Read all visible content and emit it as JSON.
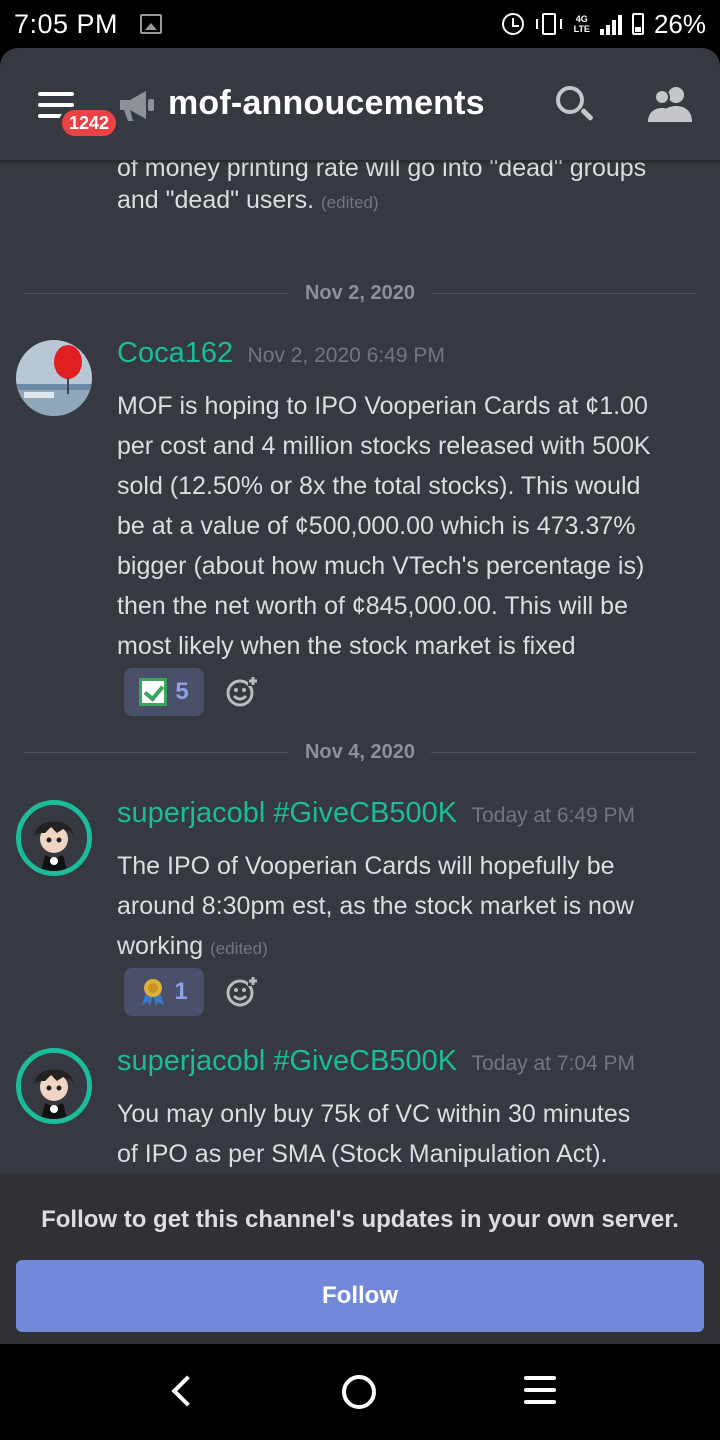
{
  "status_bar": {
    "time": "7:05 PM",
    "network": "4G\nLTE",
    "battery": "26%"
  },
  "header": {
    "unread_badge": "1242",
    "channel_name": "mof-annoucements"
  },
  "chat": {
    "previous_fragment_top": "of money printing rate will go into \"dead\" groups",
    "previous_fragment_bottom": "and \"dead\" users.",
    "edited_label": "(edited)",
    "dividers": [
      "Nov 2, 2020",
      "Nov 4, 2020"
    ],
    "messages": [
      {
        "username": "Coca162",
        "timestamp": "Nov 2, 2020 6:49 PM",
        "lines": [
          "MOF is hoping to IPO Vooperian Cards at ¢1.00",
          "per cost and 4 million stocks released with 500K",
          "sold (12.50% or 8x the total stocks). This would",
          "be at a value of ¢500,000.00 which is 473.37%",
          "bigger (about how much VTech's percentage is)",
          "then the net worth of ¢845,000.00. This will be",
          "most likely when the stock market is fixed"
        ],
        "reaction": {
          "emoji": "ballot-box-with-check",
          "count": "5"
        }
      },
      {
        "username": "superjacobl #GiveCB500K",
        "timestamp": "Today at 6:49 PM",
        "lines": [
          "The IPO of Vooperian Cards will hopefully be",
          "around 8:30pm est, as the stock market is now",
          "working"
        ],
        "edited": "(edited)",
        "reaction": {
          "emoji": "medal",
          "count": "1"
        }
      },
      {
        "username": "superjacobl #GiveCB500K",
        "timestamp": "Today at 7:04 PM",
        "lines": [
          "You may only buy 75k of VC within 30 minutes",
          "of IPO as per SMA (Stock Manipulation Act)."
        ]
      }
    ]
  },
  "follow_panel": {
    "text": "Follow to get this channel's updates in your own server.",
    "button_label": "Follow"
  },
  "colors": {
    "accent": "#7289da",
    "username": "#1abc9c",
    "badge": "#ed4245",
    "background": "#36393f"
  }
}
